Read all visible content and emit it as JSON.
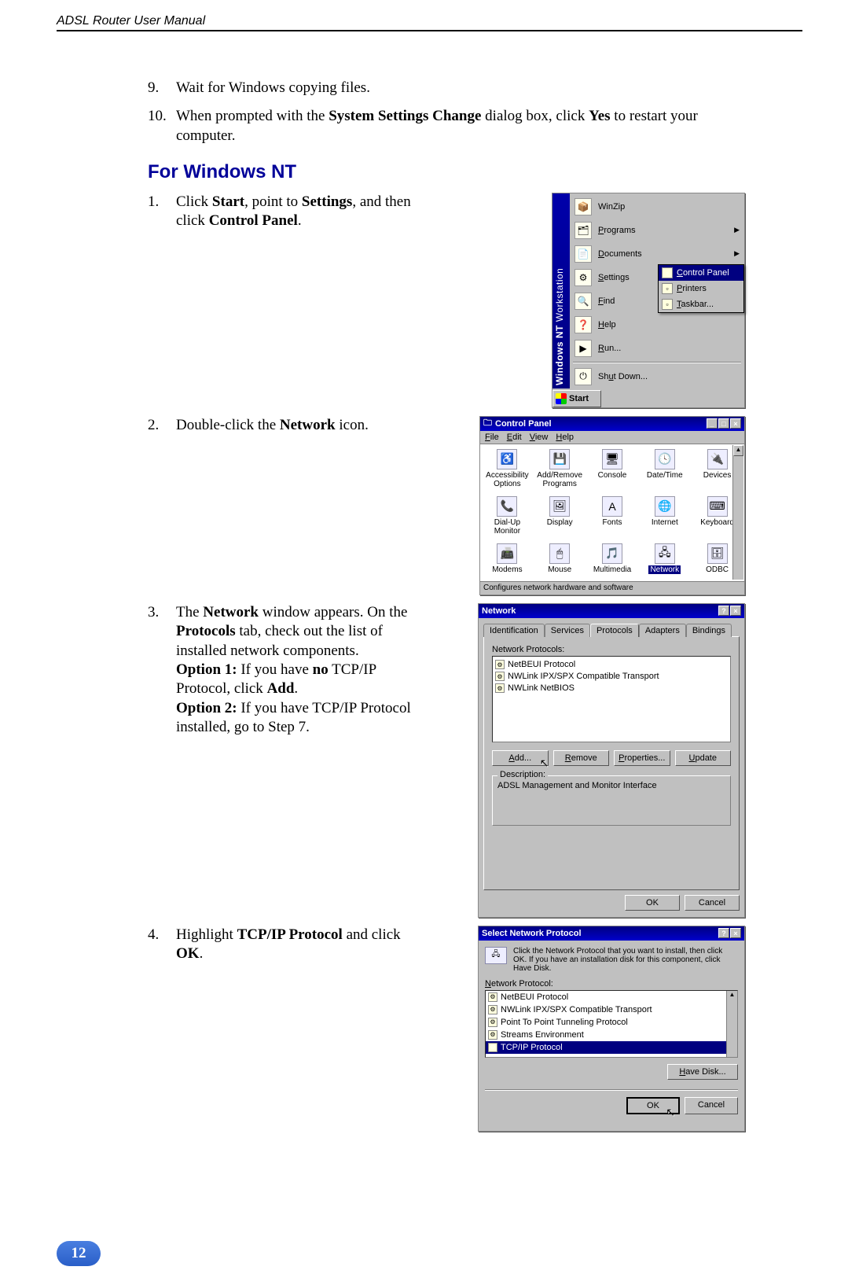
{
  "header": {
    "title": "ADSL Router User Manual"
  },
  "page_number": "12",
  "intro_steps": [
    {
      "num": "9.",
      "html": "Wait for Windows copying files."
    },
    {
      "num": "10.",
      "html": "When prompted with the <b>System Settings Change</b> dialog box, click <b>Yes</b> to restart your computer."
    }
  ],
  "section_title": "For Windows NT",
  "steps": [
    {
      "num": "1.",
      "html": "Click <b>Start</b>, point to <b>Settings</b>, and then click <b>Control Panel</b>."
    },
    {
      "num": "2.",
      "html": "Double-click the <b>Network</b> icon."
    },
    {
      "num": "3.",
      "html": "The <b>Network</b> window appears. On the <b>Protocols</b> tab, check out the list of installed network components.<br><b>Option 1:</b> If you have <b>no</b> TCP/IP Protocol, click <b>Add</b>.<br><b>Option 2:</b> If you have TCP/IP Protocol installed, go to Step 7."
    },
    {
      "num": "4.",
      "html": "Highlight <b>TCP/IP Protocol</b> and click <b>OK</b>."
    }
  ],
  "start_menu": {
    "strip_bold": "Windows NT",
    "strip_light": " Workstation",
    "items": [
      {
        "label": "WinZip",
        "icon": "📦",
        "arrow": false
      },
      {
        "label": "Programs",
        "icon": "🗂",
        "arrow": true,
        "ul": "P"
      },
      {
        "label": "Documents",
        "icon": "📄",
        "arrow": true,
        "ul": "D"
      },
      {
        "label": "Settings",
        "icon": "⚙",
        "arrow": true,
        "ul": "S"
      },
      {
        "label": "Find",
        "icon": "🔍",
        "arrow": true,
        "ul": "F"
      },
      {
        "label": "Help",
        "icon": "❓",
        "arrow": false,
        "ul": "H"
      },
      {
        "label": "Run...",
        "icon": "▶",
        "arrow": false,
        "ul": "R"
      },
      {
        "label": "Shut Down...",
        "icon": "⏻",
        "arrow": false,
        "ul": "u"
      }
    ],
    "submenu": [
      {
        "label": "Control Panel",
        "ul": "C",
        "sel": true
      },
      {
        "label": "Printers",
        "ul": "P",
        "sel": false
      },
      {
        "label": "Taskbar...",
        "ul": "T",
        "sel": false
      }
    ],
    "start_label": "Start"
  },
  "control_panel": {
    "title": "Control Panel",
    "menus": [
      "File",
      "Edit",
      "View",
      "Help"
    ],
    "items": [
      {
        "label": "Accessibility Options",
        "icon": "♿"
      },
      {
        "label": "Add/Remove Programs",
        "icon": "💾"
      },
      {
        "label": "Console",
        "icon": "🖥"
      },
      {
        "label": "Date/Time",
        "icon": "🕓"
      },
      {
        "label": "Devices",
        "icon": "🔌"
      },
      {
        "label": "Dial-Up Monitor",
        "icon": "📞"
      },
      {
        "label": "Display",
        "icon": "🖼"
      },
      {
        "label": "Fonts",
        "icon": "A"
      },
      {
        "label": "Internet",
        "icon": "🌐"
      },
      {
        "label": "Keyboard",
        "icon": "⌨"
      },
      {
        "label": "Modems",
        "icon": "📠"
      },
      {
        "label": "Mouse",
        "icon": "🖱"
      },
      {
        "label": "Multimedia",
        "icon": "🎵"
      },
      {
        "label": "Network",
        "icon": "🖧",
        "sel": true
      },
      {
        "label": "ODBC",
        "icon": "🗄"
      }
    ],
    "status": "Configures network hardware and software"
  },
  "network_dialog": {
    "title": "Network",
    "tabs": [
      "Identification",
      "Services",
      "Protocols",
      "Adapters",
      "Bindings"
    ],
    "active_tab": 2,
    "list_label": "Network Protocols:",
    "protocols": [
      "NetBEUI Protocol",
      "NWLink IPX/SPX Compatible Transport",
      "NWLink NetBIOS"
    ],
    "buttons": [
      "Add...",
      "Remove",
      "Properties...",
      "Update"
    ],
    "desc_label": "Description:",
    "desc_text": "ADSL Management and Monitor Interface",
    "ok": "OK",
    "cancel": "Cancel"
  },
  "select_protocol": {
    "title": "Select Network Protocol",
    "msg": "Click the Network Protocol that you want to install, then click OK. If you have an installation disk for this component, click Have Disk.",
    "list_label": "Network Protocol:",
    "items": [
      {
        "label": "NetBEUI Protocol"
      },
      {
        "label": "NWLink IPX/SPX Compatible Transport"
      },
      {
        "label": "Point To Point Tunneling Protocol"
      },
      {
        "label": "Streams Environment"
      },
      {
        "label": "TCP/IP Protocol",
        "sel": true
      }
    ],
    "have_disk": "Have Disk...",
    "ok": "OK",
    "cancel": "Cancel"
  }
}
